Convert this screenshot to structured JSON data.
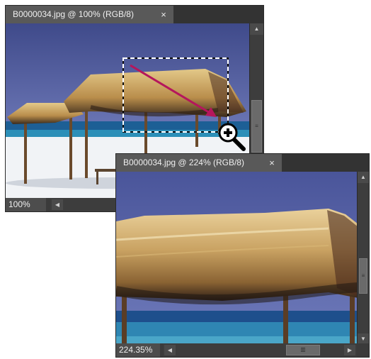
{
  "window_back": {
    "tab_title": "B0000034.jpg @ 100% (RGB/8)",
    "close_glyph": "×",
    "zoom_level": "100%",
    "scroll_up_icon": "▲",
    "scroll_down_icon": "▼",
    "scroll_left_icon": "◀",
    "thumb_grip": "≡"
  },
  "window_front": {
    "tab_title": "B0000034.jpg @ 224% (RGB/8)",
    "close_glyph": "×",
    "zoom_level": "224.35%",
    "scroll_up_icon": "▲",
    "scroll_down_icon": "▼",
    "scroll_left_icon": "◀",
    "scroll_right_icon": "▶",
    "thumb_grip": "≡",
    "hthumb_grip": "▥"
  },
  "overlay": {
    "tool_icon": "zoom-in-icon",
    "arrow_color": "#b5165c",
    "marquee_color": "#ffffff"
  }
}
